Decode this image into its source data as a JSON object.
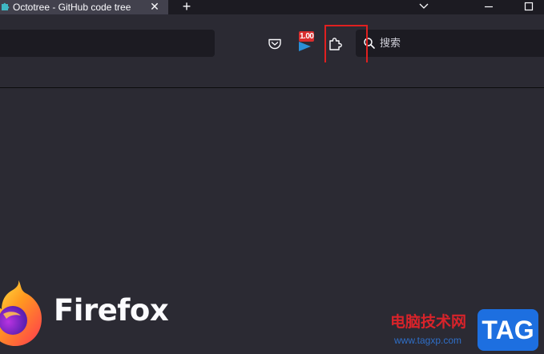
{
  "tab": {
    "title": "Octotree - GitHub code tree",
    "close_glyph": "✕",
    "favicon_icon": "octotree-puzzle-icon"
  },
  "tabstrip": {
    "new_tab_glyph": "+",
    "list_tabs_icon": "chevron-down-icon",
    "minimize_icon": "minimize-icon",
    "maximize_icon": "maximize-icon"
  },
  "toolbar": {
    "pocket_icon": "pocket-icon",
    "extension_badge": "1.00",
    "extension_icon": "octotree-extension-icon",
    "extensions_button_icon": "puzzle-piece-icon"
  },
  "search": {
    "placeholder": "搜索",
    "icon": "search-icon"
  },
  "content": {
    "wordmark": "Firefox",
    "logo_icon": "firefox-logo-icon"
  },
  "watermark": {
    "site_name": "电脑技术网",
    "url": "www.tagxp.com",
    "tag": "TAG"
  },
  "colors": {
    "chrome_dark": "#1c1b22",
    "toolbar": "#2b2a33",
    "tab_selected": "#42414d",
    "highlight_box": "#e02020",
    "text": "#fbfbfe"
  }
}
